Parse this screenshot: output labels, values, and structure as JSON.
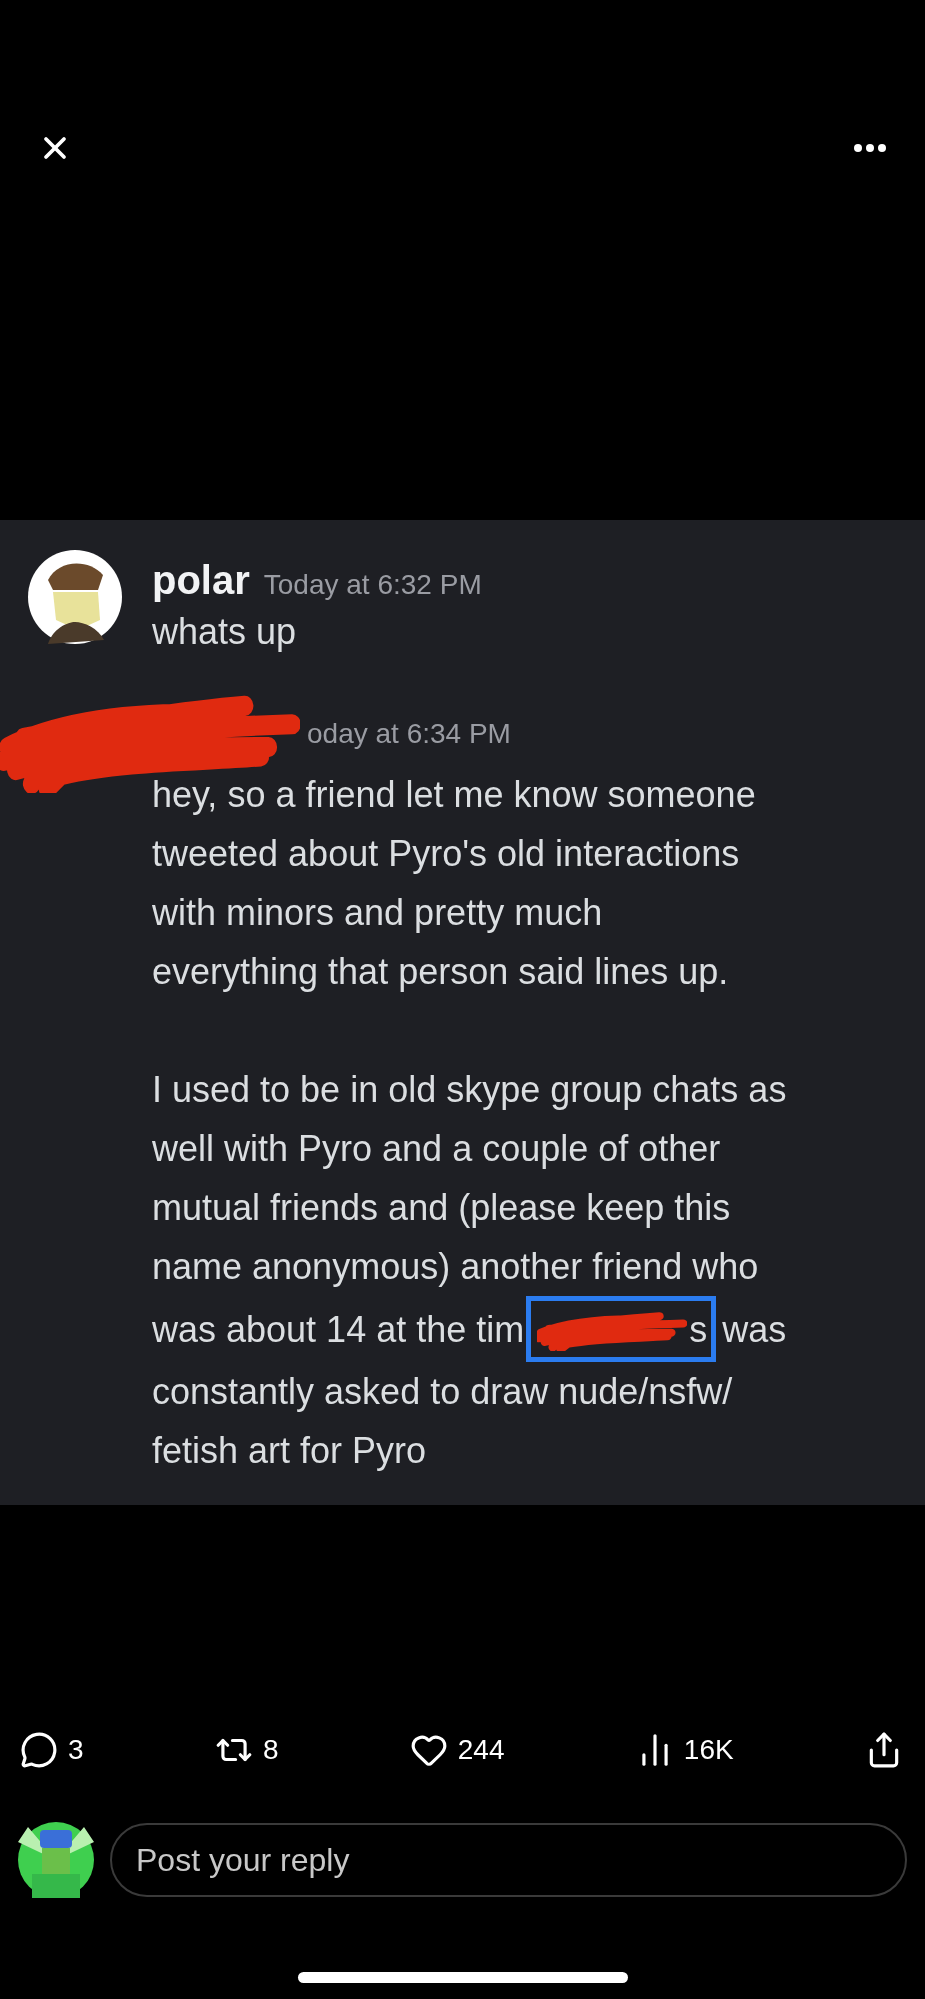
{
  "viewer": {
    "image": {
      "messages": [
        {
          "author": "polar",
          "time": "Today at 6:32 PM",
          "author_redacted": false,
          "lines": [
            {
              "kind": "text",
              "text": "whats up"
            }
          ]
        },
        {
          "time": "oday at 6:34 PM",
          "author_redacted": true,
          "lines": [
            {
              "kind": "text",
              "text": "hey, so a friend let me know someone"
            },
            {
              "kind": "text",
              "text": "tweeted about Pyro's old interactions"
            },
            {
              "kind": "text",
              "text": "with minors and pretty much"
            },
            {
              "kind": "text",
              "text": "everything that person said lines up."
            },
            {
              "kind": "gap"
            },
            {
              "kind": "text",
              "text": "I used to be in old skype group chats as"
            },
            {
              "kind": "text",
              "text": "well with Pyro and a couple of other"
            },
            {
              "kind": "text",
              "text": "mutual friends and (please keep this"
            },
            {
              "kind": "text",
              "text": "name anonymous) another friend who"
            },
            {
              "kind": "redacted",
              "before": "was about 14 at the tim",
              "boxed": "s",
              "after": "was"
            },
            {
              "kind": "text",
              "text": "constantly asked to draw nude/nsfw/"
            },
            {
              "kind": "text",
              "text": "fetish art for Pyro"
            }
          ]
        }
      ]
    }
  },
  "actions": [
    {
      "kind": "reply",
      "count": "3"
    },
    {
      "kind": "repost",
      "count": "8"
    },
    {
      "kind": "like",
      "count": "244"
    },
    {
      "kind": "views",
      "count": "16K"
    },
    {
      "kind": "share"
    }
  ],
  "reply_field": {
    "placeholder": "Post your reply"
  }
}
